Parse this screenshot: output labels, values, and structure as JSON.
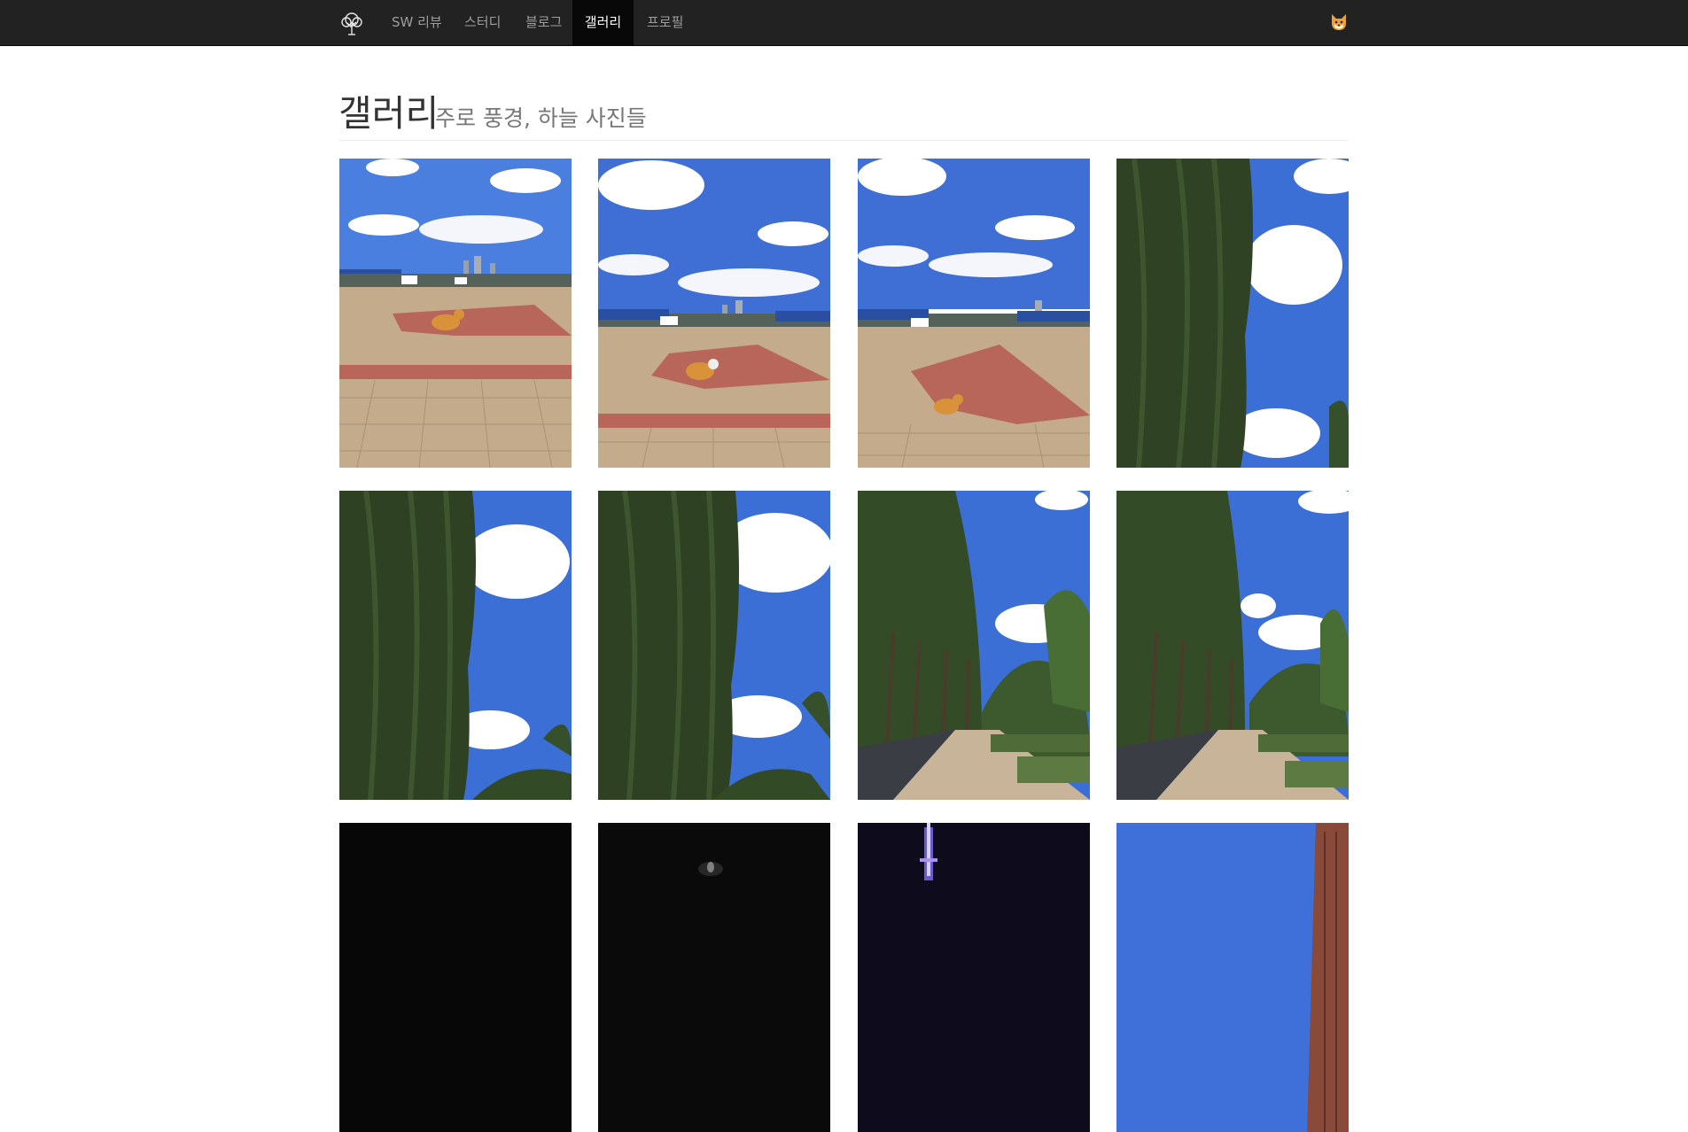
{
  "navbar": {
    "brand_icon": "tree-icon",
    "items": [
      {
        "label": "SW 리뷰",
        "active": false
      },
      {
        "label": "스터디",
        "active": false
      },
      {
        "label": "블로그",
        "active": false
      },
      {
        "label": "갤러리",
        "active": true
      },
      {
        "label": "프로필",
        "active": false
      }
    ],
    "avatar_icon": "fox-icon"
  },
  "page": {
    "title": "갤러리",
    "subtitle": "주로 풍경, 하늘 사진들"
  },
  "gallery": {
    "photos": [
      {
        "scene": "corgi-on-plaza"
      },
      {
        "scene": "corgi-on-plaza"
      },
      {
        "scene": "corgi-on-plaza"
      },
      {
        "scene": "poplar-tree-sky"
      },
      {
        "scene": "poplar-tree-sky"
      },
      {
        "scene": "poplar-tree-sky"
      },
      {
        "scene": "tree-lined-path"
      },
      {
        "scene": "tree-lined-path"
      },
      {
        "scene": "night-scene"
      },
      {
        "scene": "night-scene"
      },
      {
        "scene": "night-tower"
      },
      {
        "scene": "sky-building"
      }
    ]
  },
  "colors": {
    "navbar_bg": "#222222",
    "nav_active_bg": "#080808",
    "nav_text": "#9d9d9d",
    "sky": "#3c6fd6",
    "pavement": "#c2a98a",
    "red_brick": "#b05a4d",
    "foliage": "#2f4224"
  }
}
